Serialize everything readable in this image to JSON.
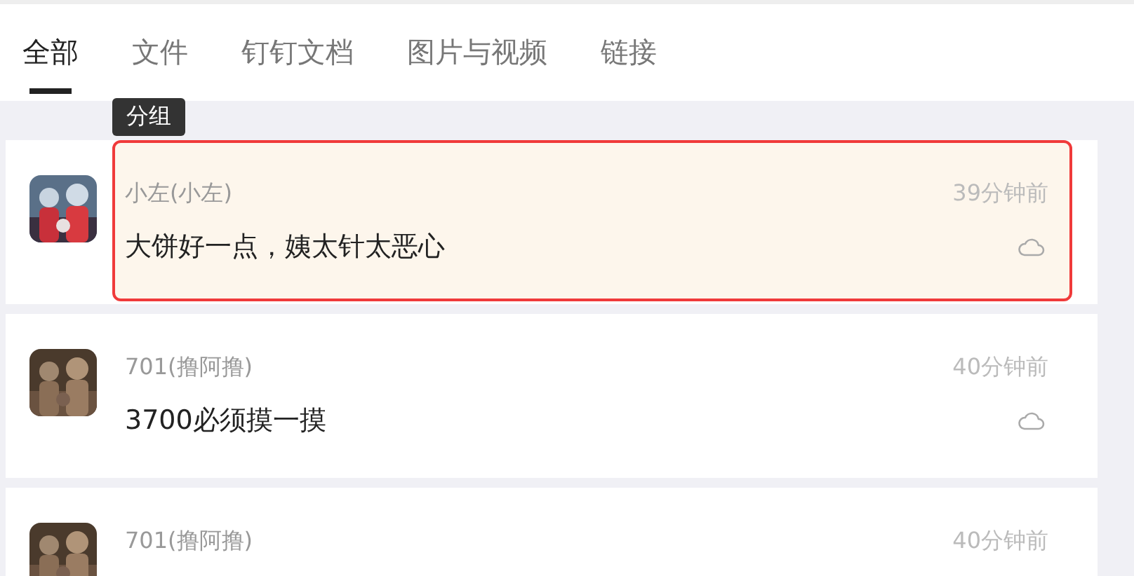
{
  "tabs": [
    {
      "label": "全部",
      "selected": true
    },
    {
      "label": "文件",
      "selected": false
    },
    {
      "label": "钉钉文档",
      "selected": false
    },
    {
      "label": "图片与视频",
      "selected": false
    },
    {
      "label": "链接",
      "selected": false
    }
  ],
  "tooltip": "分组",
  "messages": [
    {
      "sender": "小左(小左)",
      "time": "39分钟前",
      "text": "大饼好一点，姨太针太恶心",
      "highlighted": true
    },
    {
      "sender": "701(撸阿撸)",
      "time": "40分钟前",
      "text": "3700必须摸一摸",
      "highlighted": false
    },
    {
      "sender": "701(撸阿撸)",
      "time": "40分钟前",
      "highlighted": false
    }
  ]
}
